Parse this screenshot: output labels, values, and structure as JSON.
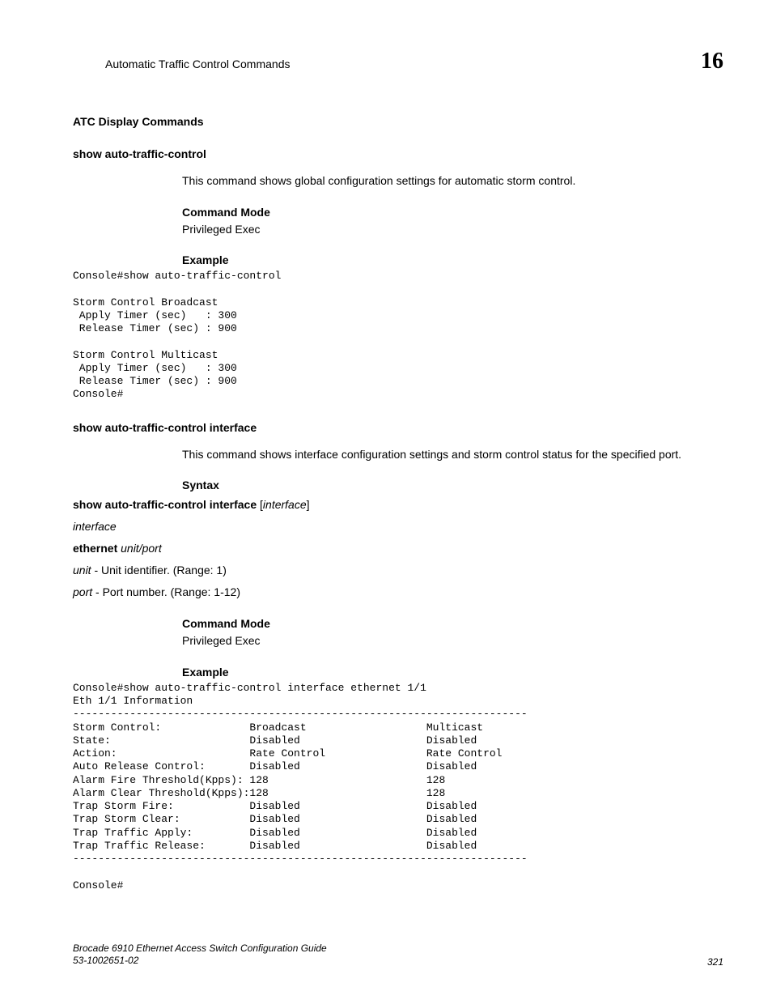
{
  "header": {
    "title": "Automatic Traffic Control Commands",
    "chapter": "16"
  },
  "sections": {
    "atc_display_heading": "ATC Display Commands",
    "show_atc": {
      "heading": "show auto-traffic-control",
      "desc": "This command shows global configuration settings for automatic storm control.",
      "cmd_mode_label": "Command Mode",
      "cmd_mode_value": "Privileged Exec",
      "example_label": "Example",
      "example_code": "Console#show auto-traffic-control\n\nStorm Control Broadcast\n Apply Timer (sec)   : 300\n Release Timer (sec) : 900\n\nStorm Control Multicast\n Apply Timer (sec)   : 300\n Release Timer (sec) : 900\nConsole#"
    },
    "show_atc_if": {
      "heading": "show auto-traffic-control interface",
      "desc": "This command shows interface configuration settings and storm control status for the specified port.",
      "syntax_label": "Syntax",
      "syntax_cmd_bold": "show auto-traffic-control interface",
      "syntax_cmd_bracket_open": " [",
      "syntax_cmd_arg": "interface",
      "syntax_cmd_bracket_close": "]",
      "interface_word": "interface",
      "ethernet_bold": "ethernet",
      "ethernet_args": " unit/port",
      "unit_italic": "unit",
      "unit_desc": " - Unit identifier. (Range: 1)",
      "port_italic": "port",
      "port_desc": " - Port number. (Range: 1-12)",
      "cmd_mode_label": "Command Mode",
      "cmd_mode_value": "Privileged Exec",
      "example_label": "Example",
      "example_code": "Console#show auto-traffic-control interface ethernet 1/1\nEth 1/1 Information\n------------------------------------------------------------------------\nStorm Control:              Broadcast                   Multicast\nState:                      Disabled                    Disabled\nAction:                     Rate Control                Rate Control\nAuto Release Control:       Disabled                    Disabled\nAlarm Fire Threshold(Kpps): 128                         128\nAlarm Clear Threshold(Kpps):128                         128\nTrap Storm Fire:            Disabled                    Disabled\nTrap Storm Clear:           Disabled                    Disabled\nTrap Traffic Apply:         Disabled                    Disabled\nTrap Traffic Release:       Disabled                    Disabled\n------------------------------------------------------------------------\n\nConsole#"
    }
  },
  "footer": {
    "guide": "Brocade 6910 Ethernet Access Switch Configuration Guide",
    "partno": "53-1002651-02",
    "pageno": "321"
  }
}
